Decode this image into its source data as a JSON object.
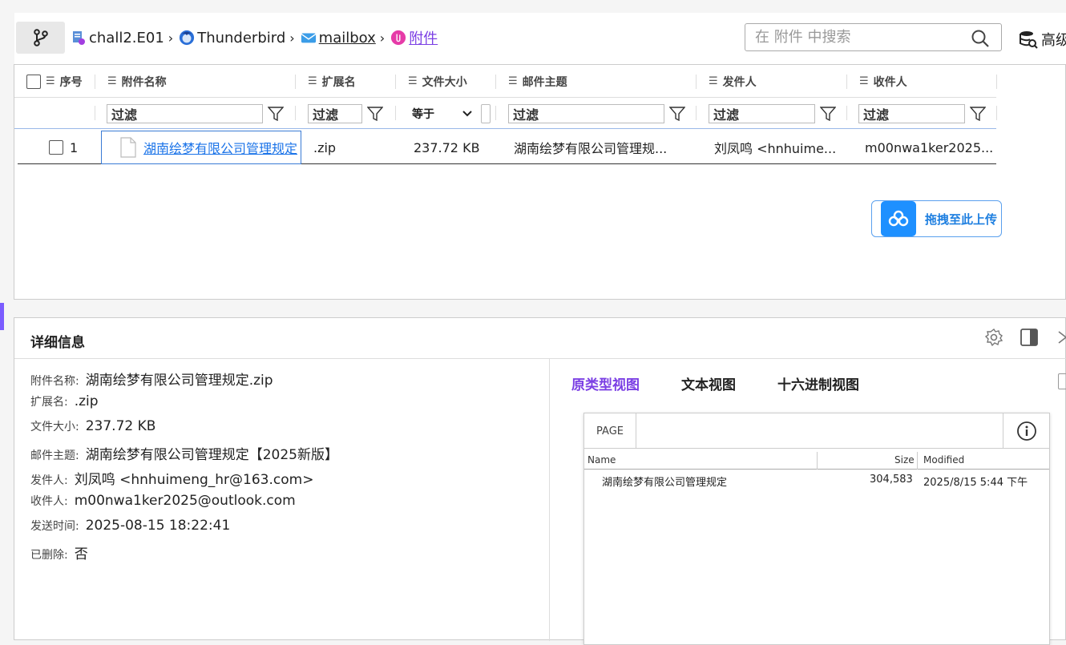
{
  "breadcrumb": [
    {
      "label": "chall2.E01",
      "icon": "evidence-file-icon"
    },
    {
      "label": "Thunderbird",
      "icon": "thunderbird-icon"
    },
    {
      "label": "mailbox",
      "icon": "mail-icon"
    },
    {
      "label": "附件",
      "icon": "attachment-icon"
    }
  ],
  "search": {
    "placeholder": "在 附件 中搜索"
  },
  "advanced_label": "高级",
  "columns": {
    "index": "序号",
    "name": "附件名称",
    "ext": "扩展名",
    "size": "文件大小",
    "subject": "邮件主题",
    "sender": "发件人",
    "recipient": "收件人"
  },
  "filters": {
    "placeholder": "过滤",
    "size_operator": "等于"
  },
  "rows": [
    {
      "index": "1",
      "name": "湖南绘梦有限公司管理规定",
      "ext": ".zip",
      "size": "237.72 KB",
      "subject": "湖南绘梦有限公司管理规...",
      "sender": "刘凤鸣 <hnhuime...",
      "recipient": "m00nwa1ker2025..."
    }
  ],
  "upload_button": "拖拽至此上传",
  "detail": {
    "title": "详细信息",
    "fields": [
      {
        "k": "附件名称:",
        "v": "湖南绘梦有限公司管理规定.zip"
      },
      {
        "k": "扩展名:",
        "v": ".zip"
      },
      {
        "k": "文件大小:",
        "v": "237.72 KB"
      },
      {
        "k": "邮件主题:",
        "v": "湖南绘梦有限公司管理规定【2025新版】"
      },
      {
        "k": "发件人:",
        "v": "刘凤鸣 <hnhuimeng_hr@163.com>"
      },
      {
        "k": "收件人:",
        "v": "m00nwa1ker2025@outlook.com"
      },
      {
        "k": "发送时间:",
        "v": "2025-08-15 18:22:41"
      },
      {
        "k": "已删除:",
        "v": "否"
      }
    ],
    "tabs": [
      "原类型视图",
      "文本视图",
      "十六进制视图"
    ]
  },
  "preview": {
    "page_label": "PAGE",
    "headers": {
      "name": "Name",
      "size": "Size",
      "modified": "Modified"
    },
    "row": {
      "name": "湖南绘梦有限公司管理规定",
      "size": "304,583",
      "modified": "2025/8/15 5:44 下午"
    }
  },
  "colors": {
    "accent": "#7b3fe4",
    "link": "#1a73e8",
    "upload": "#1e90ff"
  }
}
